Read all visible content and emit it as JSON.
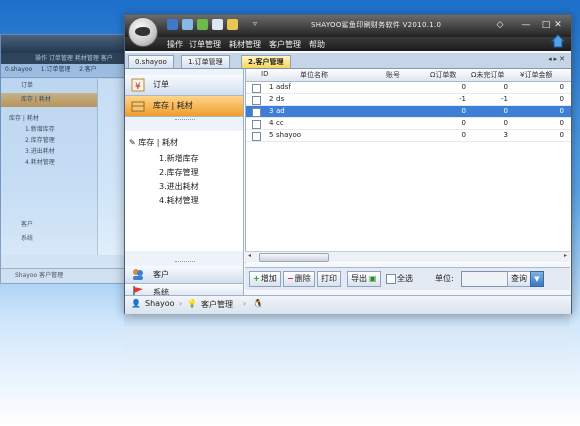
{
  "window": {
    "title": "SHAYOO鲨鱼印刷财务软件 V2010.1.0",
    "controls": [
      "◇",
      "—",
      "□",
      "✕"
    ]
  },
  "menu": [
    "操作",
    "订单管理",
    "耗材管理",
    "客户管理",
    "帮助"
  ],
  "tabs": [
    {
      "label": "0.shayoo"
    },
    {
      "label": "1.订单管理"
    },
    {
      "label": "2.客户管理",
      "active": true
    }
  ],
  "sidebar": {
    "orders": "订单",
    "inventory": "库存 | 耗材",
    "tree_root": "库存 | 耗材",
    "tree_items": [
      "1.新增库存",
      "2.库存管理",
      "3.进出耗材",
      "4.耗材管理"
    ],
    "customers": "客户",
    "system": "系统"
  },
  "grid": {
    "columns": [
      "ID",
      "单位名称",
      "账号",
      "Ω订单数",
      "Ω未完订单",
      "¥订单金额"
    ],
    "rows": [
      {
        "id": "1",
        "name": "adsf",
        "account": "",
        "orders": "0",
        "pending": "0",
        "amount": "0"
      },
      {
        "id": "2",
        "name": "ds",
        "account": "",
        "orders": "-1",
        "pending": "-1",
        "amount": "0"
      },
      {
        "id": "3",
        "name": "ad",
        "account": "",
        "orders": "0",
        "pending": "0",
        "amount": "0",
        "selected": true
      },
      {
        "id": "4",
        "name": "cc",
        "account": "",
        "orders": "0",
        "pending": "0",
        "amount": "0"
      },
      {
        "id": "5",
        "name": "shayoo",
        "account": "",
        "orders": "0",
        "pending": "3",
        "amount": "0"
      }
    ]
  },
  "actions": {
    "add": "增加",
    "delete": "删除",
    "print": "打印",
    "export": "导出",
    "select_all": "全选",
    "unit_label": "单位:",
    "unit_value": "",
    "query": "查询"
  },
  "statusbar": {
    "user": "Shayoo",
    "module": "客户管理"
  },
  "ghost": {
    "menu": "操作 订单管理 耗材管理 客户",
    "tabs": [
      "0.shayoo",
      "1.订单管理",
      "2.客户"
    ],
    "items": [
      "订单",
      "库存 | 耗材",
      "库存 | 耗材",
      "1.新增库存",
      "2.库存管理",
      "3.进出耗材",
      "4.耗材管理",
      "客户",
      "系统"
    ],
    "status": "Shayoo   客户管理"
  },
  "colors": {
    "accent_selected_row": "#3d7fd6",
    "active_tab": "#f6d55a",
    "section_selected": "#ef9d2d",
    "titlebar": "#222222"
  }
}
